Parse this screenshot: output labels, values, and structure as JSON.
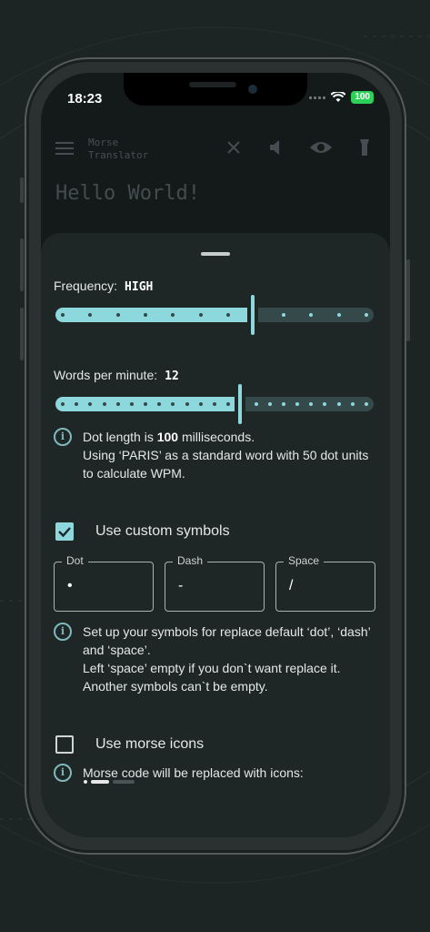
{
  "status_bar": {
    "time": "18:23",
    "battery": "100"
  },
  "app_bar": {
    "title": "Morse\nTranslator"
  },
  "input": {
    "text": "Hello World!"
  },
  "sheet": {
    "frequency": {
      "label": "Frequency:",
      "value": "HIGH",
      "level": 0.62
    },
    "wpm": {
      "label": "Words per minute:",
      "value": "12",
      "level": 0.58
    },
    "dot_info": {
      "prefix": "Dot length is ",
      "value": "100",
      "suffix": " milliseconds.",
      "line2": "Using ‘PARIS’ as a standard word with 50 dot units",
      "line3": "to calculate WPM."
    },
    "custom_symbols": {
      "label": "Use custom symbols",
      "checked": true
    },
    "fields": [
      {
        "label": "Dot",
        "value": "•"
      },
      {
        "label": "Dash",
        "value": "-"
      },
      {
        "label": "Space",
        "value": "/"
      }
    ],
    "symbols_info": {
      "line1": "Set up your symbols for replace default ‘dot’, ‘dash’",
      "line2": "and ‘space’.",
      "line3": "Left ‘space’ empty if you don`t want replace it.",
      "line4": "Another symbols can`t be empty."
    },
    "morse_icons": {
      "label": "Use morse icons",
      "checked": false
    },
    "icons_info": {
      "line1": "Morse code will be replaced with icons:"
    }
  },
  "colors": {
    "accent": "#8dd8dc",
    "track_inactive": "#36494a",
    "sheet_bg": "#1e2626"
  }
}
